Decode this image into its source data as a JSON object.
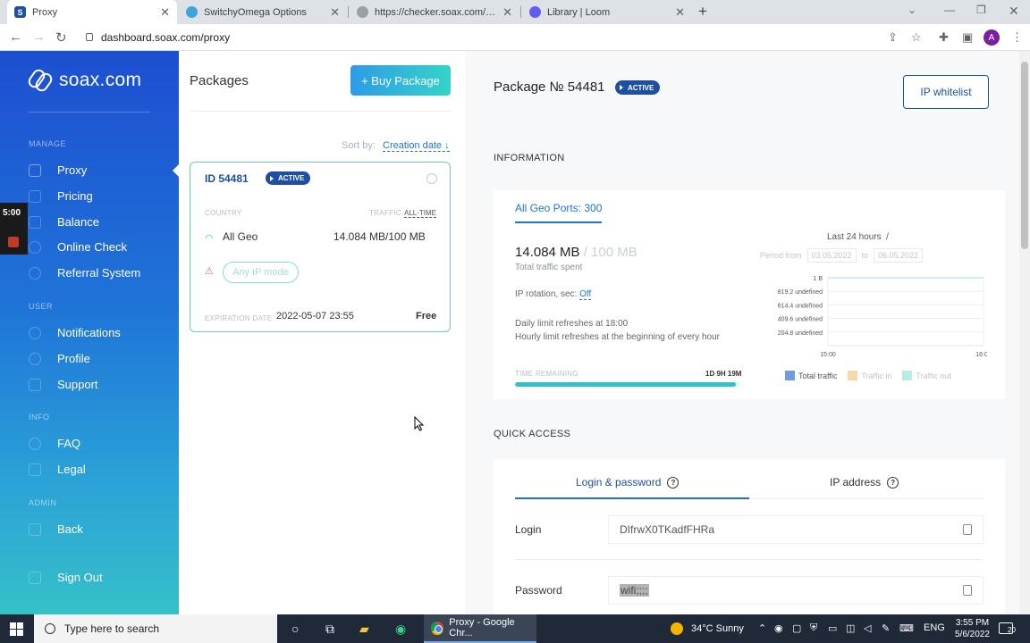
{
  "browser": {
    "tabs": [
      {
        "title": "Proxy",
        "active": true
      },
      {
        "title": "SwitchyOmega Options",
        "active": false
      },
      {
        "title": "https://checker.soax.com/api/ipi...",
        "active": false
      },
      {
        "title": "Library | Loom",
        "active": false
      }
    ],
    "url": "dashboard.soax.com/proxy",
    "profile_initial": "A"
  },
  "sidebar": {
    "logo": "soax.com",
    "sections": {
      "manage": "MANAGE",
      "user": "USER",
      "info": "INFO",
      "admin": "ADMIN"
    },
    "items": [
      {
        "label": "Proxy",
        "icon": "server-icon"
      },
      {
        "label": "Pricing",
        "icon": "price-tag-icon"
      },
      {
        "label": "Balance",
        "icon": "wallet-icon"
      },
      {
        "label": "Online Check",
        "icon": "check-circle-icon"
      },
      {
        "label": "Referral System",
        "icon": "users-icon"
      },
      {
        "label": "Notifications",
        "icon": "bell-icon"
      },
      {
        "label": "Profile",
        "icon": "user-icon"
      },
      {
        "label": "Support",
        "icon": "chat-icon"
      },
      {
        "label": "FAQ",
        "icon": "help-icon"
      },
      {
        "label": "Legal",
        "icon": "document-icon"
      },
      {
        "label": "Back",
        "icon": "logout-icon"
      },
      {
        "label": "Sign Out",
        "icon": "signout-icon"
      }
    ]
  },
  "loom": {
    "time": "5:00"
  },
  "packages": {
    "title": "Packages",
    "buy_button": "+ Buy Package",
    "sort_label": "Sort by:",
    "sort_value": "Creation date ↓",
    "card": {
      "id": "ID  54481",
      "status": "ACTIVE",
      "country_label": "COUNTRY",
      "traffic_label": "TRAFFIC",
      "alltime_label": "ALL-TIME",
      "geo": "All Geo",
      "traffic": "14.084 MB/100 MB",
      "mode": "Any IP mode",
      "expiration_label": "EXPIRATION DATE",
      "expiration_date": "2022-05-07 23:55",
      "plan": "Free"
    }
  },
  "detail": {
    "title": "Package № 54481",
    "status": "ACTIVE",
    "whitelist_button": "IP whitelist",
    "info_title": "INFORMATION",
    "tab_label": "All Geo Ports: 300",
    "used": "14.084 MB",
    "limit": "/ 100 MB",
    "spent_label": "Total traffic spent",
    "rotation_label": "IP rotation, sec:",
    "rotation_value": "Off",
    "daily_refresh": "Daily limit refreshes at 18:00",
    "hourly_refresh": "Hourly limit refreshes at the beginning of every hour",
    "time_remaining_label": "TIME REMAINING",
    "time_remaining_value": "1D 9H 19M",
    "time_remaining_fraction": 0.98,
    "range_label": "Last 24 hours",
    "range_suffix": "/",
    "period_from_label": "Period from",
    "period_from": "03.05.2022",
    "period_to_label": "to",
    "period_to": "06.05.2022",
    "quick_title": "QUICK ACCESS",
    "quick_tabs": [
      "Login & password",
      "IP address"
    ],
    "login_label": "Login",
    "login_value": "DIfrwX0TKadfFHRa",
    "password_label": "Password",
    "password_value": "wifi;;;;"
  },
  "chart_data": {
    "type": "line",
    "yticks": [
      "1 B",
      "819.2 undefined",
      "614.4 undefined",
      "409.6 undefined",
      "204.8 undefined"
    ],
    "xticks": [
      "15:00",
      "16:00"
    ],
    "series": [
      {
        "name": "Total traffic",
        "color": "#6f9ae6",
        "values": [
          1,
          1
        ]
      },
      {
        "name": "Traffic in",
        "color": "#f8d9a8"
      },
      {
        "name": "Traffic out",
        "color": "#b4ede6"
      }
    ]
  },
  "taskbar": {
    "search_placeholder": "Type here to search",
    "chrome_label": "Proxy - Google Chr...",
    "weather": "34°C  Sunny",
    "lang": "ENG",
    "time": "3:55 PM",
    "date": "5/6/2022",
    "notifications": "20"
  }
}
